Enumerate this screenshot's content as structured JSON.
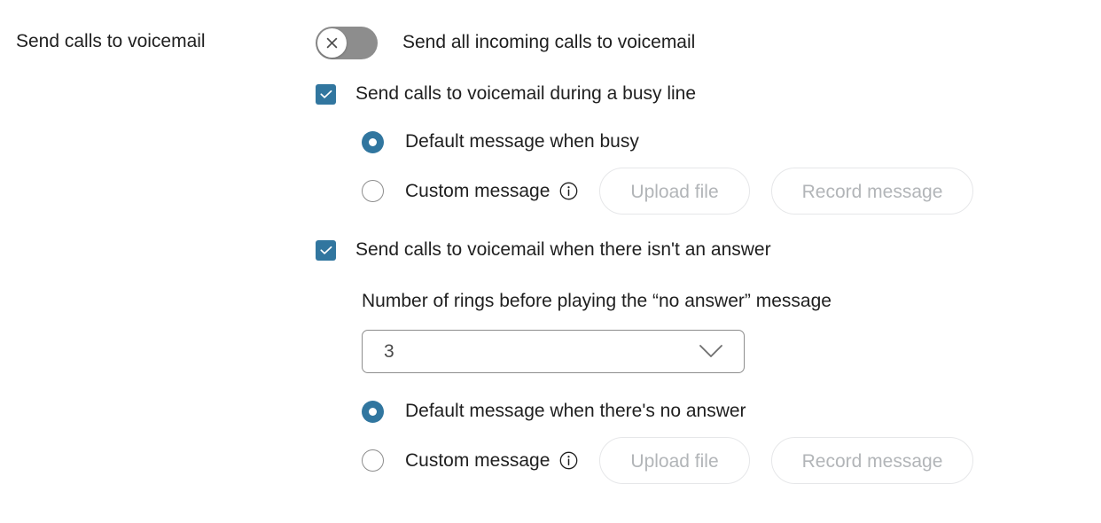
{
  "section": {
    "label": "Send calls to voicemail"
  },
  "toggle": {
    "name": "send-all-incoming-calls-toggle",
    "label": "Send all incoming calls to voicemail",
    "state": "off",
    "icon": "close-x-icon",
    "track_color": "#8d8d8d",
    "knob_color": "#ffffff"
  },
  "busy": {
    "checkbox": {
      "label": "Send calls to voicemail during a busy line",
      "checked": true
    },
    "options": [
      {
        "label": "Default message when busy",
        "selected": true,
        "has_info": false
      },
      {
        "label": "Custom message",
        "selected": false,
        "has_info": true,
        "info_icon": "info-circle-icon",
        "buttons": [
          {
            "label": "Upload file",
            "disabled": true
          },
          {
            "label": "Record message",
            "disabled": true
          }
        ]
      }
    ]
  },
  "no_answer": {
    "checkbox": {
      "label": "Send calls to voicemail when there isn't an answer",
      "checked": true
    },
    "rings": {
      "label": "Number of rings before playing the “no answer” message",
      "value": "3",
      "chevron_icon": "chevron-down-icon"
    },
    "options": [
      {
        "label": "Default message when there's no answer",
        "selected": true,
        "has_info": false
      },
      {
        "label": "Custom message",
        "selected": false,
        "has_info": true,
        "info_icon": "info-circle-icon",
        "buttons": [
          {
            "label": "Upload file",
            "disabled": true
          },
          {
            "label": "Record message",
            "disabled": true
          }
        ]
      }
    ]
  },
  "colors": {
    "accent": "#31769f",
    "text": "#1f1f1f",
    "disabled_text": "#b2b5b8",
    "border": "#e6e7e9"
  }
}
